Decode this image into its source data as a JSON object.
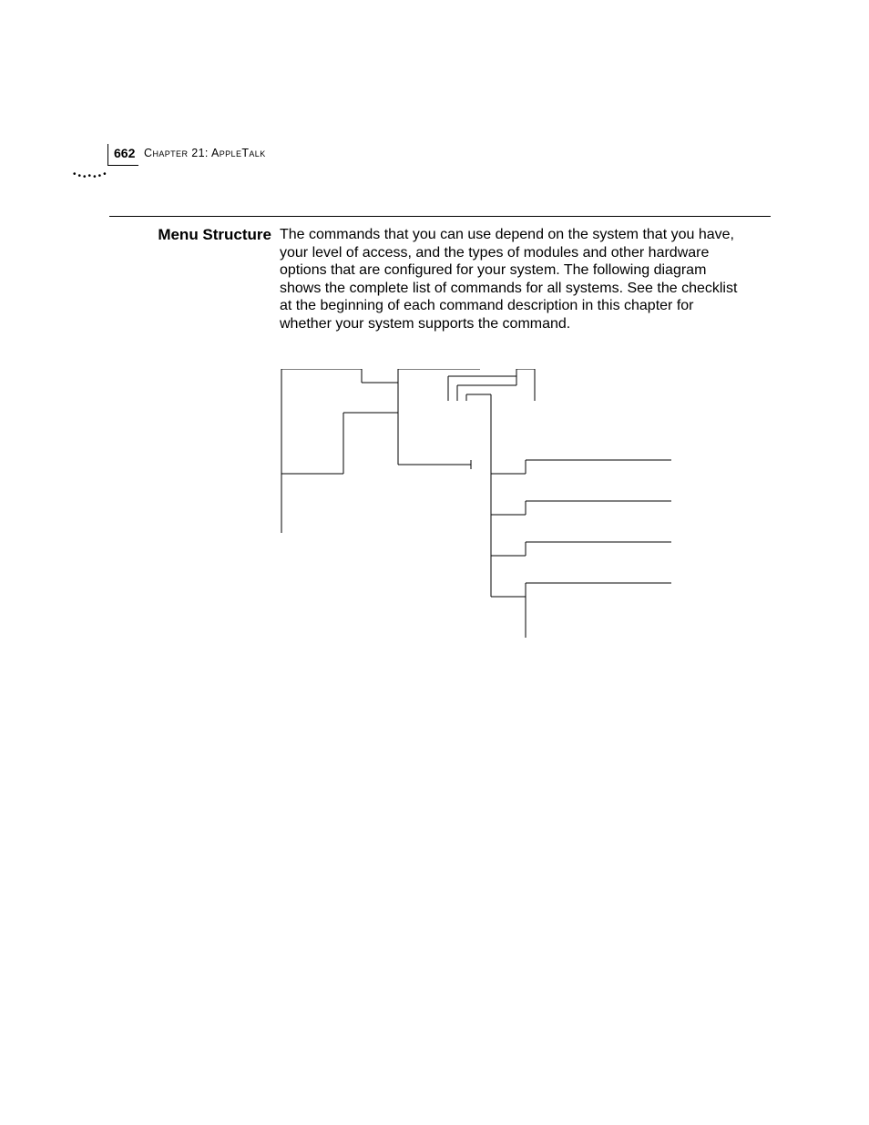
{
  "page_number": "662",
  "chapter_prefix": "C",
  "chapter_word": "HAPTER",
  "chapter_num": " 21: ",
  "topic_prefix": "A",
  "topic_mid": "PPLE",
  "topic_prefix2": "T",
  "topic_end": "ALK",
  "section_title": "Menu Structure",
  "body": "The commands that you can use depend on the system that you have, your level of access, and the types of modules and other hardware options that are configured for your system. The following diagram shows the complete list of commands for all systems. See the checklist at the beginning of each command description in this chapter for whether your system supports the command."
}
